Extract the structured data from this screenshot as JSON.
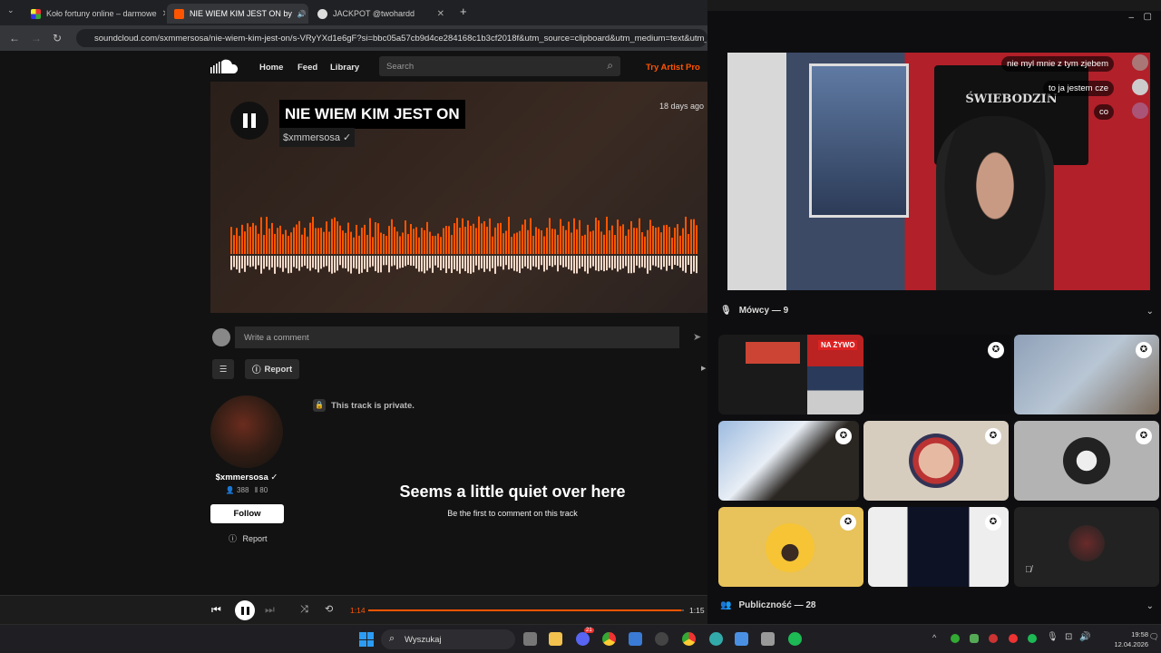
{
  "browser": {
    "tabs": [
      {
        "label": "Koło fortuny online – darmowe",
        "active": false
      },
      {
        "label": "NIE WIEM KIM JEST ON by",
        "active": true
      },
      {
        "label": "JACKPOT @twohardd",
        "active": false
      }
    ],
    "url": "soundcloud.com/sxmmersosa/nie-wiem-kim-jest-on/s-VRyYXd1e6gF?si=bbc05a57cb9d4ce284168c1b3cf2018f&utm_source=clipboard&utm_medium=text&utm_ca"
  },
  "soundcloud": {
    "nav": {
      "home": "Home",
      "feed": "Feed",
      "library": "Library",
      "search_placeholder": "Search",
      "try_pro": "Try Artist Pro"
    },
    "track": {
      "title": "NIE WIEM KIM JEST ON",
      "artist": "$xmmersosa ✓",
      "posted": "18 days ago",
      "time_current": "1:14",
      "time_total": "1:15"
    },
    "comment_placeholder": "Write a comment",
    "report_label": "Report",
    "private_notice": "This track is private.",
    "user": {
      "name": "$xmmersosa ✓",
      "followers": "388",
      "tracks": "80"
    },
    "follow_label": "Follow",
    "report2_label": "Report",
    "empty": {
      "title": "Seems a little quiet over here",
      "subtitle": "Be the first to comment on this track"
    },
    "playback_progress": 0.99
  },
  "discord": {
    "chat": [
      "nie myl mnie z tym zjebem",
      "to ja jestem cze",
      "co"
    ],
    "speakers_label": "Mówcy — 9",
    "audience_label": "Publiczność — 28",
    "live_badge": "NA ŻYWO"
  },
  "taskbar": {
    "search": "Wyszukaj",
    "time": "19:58",
    "date": "12.04.2026",
    "discord_badge": "21"
  }
}
